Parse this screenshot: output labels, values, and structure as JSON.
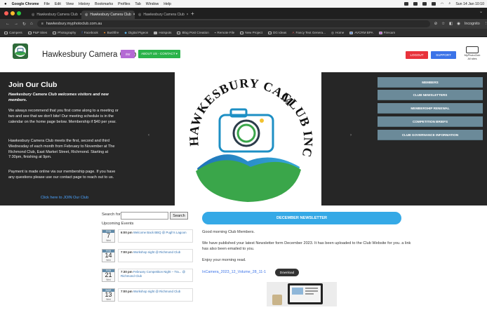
{
  "menubar": {
    "app": "Google Chrome",
    "items": [
      "File",
      "Edit",
      "View",
      "History",
      "Bookmarks",
      "Profiles",
      "Tab",
      "Window",
      "Help"
    ],
    "clock": "Sun 14 Jan 10:10"
  },
  "tabs": [
    {
      "label": "Hawkesbury Camera Club",
      "active": false
    },
    {
      "label": "Hawkesbury Camera Club",
      "active": true
    },
    {
      "label": "Hawkesbury Camera Club",
      "active": false
    }
  ],
  "toolbar": {
    "url": "hawkesbury.myphotoclub.com.au",
    "profile": "Incognito"
  },
  "bookmarks": [
    "Campers",
    "P&P Sites",
    "Photography",
    "Facebook",
    "Bushfire",
    "Digital Pigeon",
    "Hotspots",
    "Blog Post Creation",
    "Remote File",
    "New Project",
    "DG Ideas",
    "Fancy Text Genera...",
    "Home",
    "AVCRM BPA",
    "Firecam"
  ],
  "site": {
    "title": "Hawkesbury Camera Club",
    "purple_btn": "I/W",
    "about_btn": "ABOUT US - CONTACT ▾",
    "logout_btn": "LOGOUT",
    "support_btn": "SUPPORT",
    "mpc_line1": "MyPhotoClub",
    "mpc_line2": "All sites"
  },
  "hero": {
    "title": "Join Our Club",
    "intro": "Hawkesbury Camera Club welcomes visitors and new members.",
    "p1": "We always recommend that you first come along to a meeting or two and see that we don't bite! Our meeting schedule is in the calendar on the home page below. Membership if $40 per year.",
    "p2": "Hawkesbury Camera Club meets the first, second and third Wednesday of each month from February to November at The Richmond Club, East Market Street, Richmond. Starting at 7:30pm, finishing at 9pm.",
    "p3": "Payment is made online via our membership page. If you have any questions please use our contact page to reach out to us.",
    "link": "Click here to JOIN Our Club",
    "logo_top": "HAWKESBURY CAMERA",
    "logo_right": "CLUB INC.",
    "prev": "‹",
    "next": "›"
  },
  "menu": [
    "MEMBERS",
    "CLUB NEWSLETTERS",
    "MEMBERSHIP RENEWAL",
    "COMPETITION BRIEFS",
    "CLUB GOVERNANCE INFORMATION"
  ],
  "search": {
    "label": "Search for:",
    "button": "Search",
    "value": ""
  },
  "events": {
    "heading": "Upcoming Events",
    "items": [
      {
        "mon": "FEB",
        "day": "7",
        "wd": "Wed",
        "time": "6:00 pm",
        "text": "Welcome Back BBQ @ Pugh's Lagoon"
      },
      {
        "mon": "FEB",
        "day": "14",
        "wd": "Wed",
        "time": "7:00 pm",
        "text": "Workshop night @ Richmond Club"
      },
      {
        "mon": "FEB",
        "day": "21",
        "wd": "Wed",
        "time": "7:30 pm",
        "text": "February Competition Night – Tra... @ Richmond Club"
      },
      {
        "mon": "MAR",
        "day": "13",
        "wd": "Wed",
        "time": "7:00 pm",
        "text": "Workshop night @ Richmond Club"
      }
    ]
  },
  "newsletter": {
    "button": "DECEMBER NEWSLETTER",
    "greeting": "Good morning Club Members.",
    "body": "We have published your latest Newsletter form December 2023. It has been uploaded to the Club Website for you. a link has also been emailed to you.",
    "enjoy": "Enjoy your morning read.",
    "file": "InCamera_2023_12_Volume_28_11-1",
    "download": "Download"
  },
  "colors": {
    "hero_bg": "#262626",
    "menu_bg": "#6b8a99",
    "accent_blue": "#35a9e6",
    "logout": "#e8323b",
    "support": "#3b73e8",
    "about": "#2ab34a"
  }
}
